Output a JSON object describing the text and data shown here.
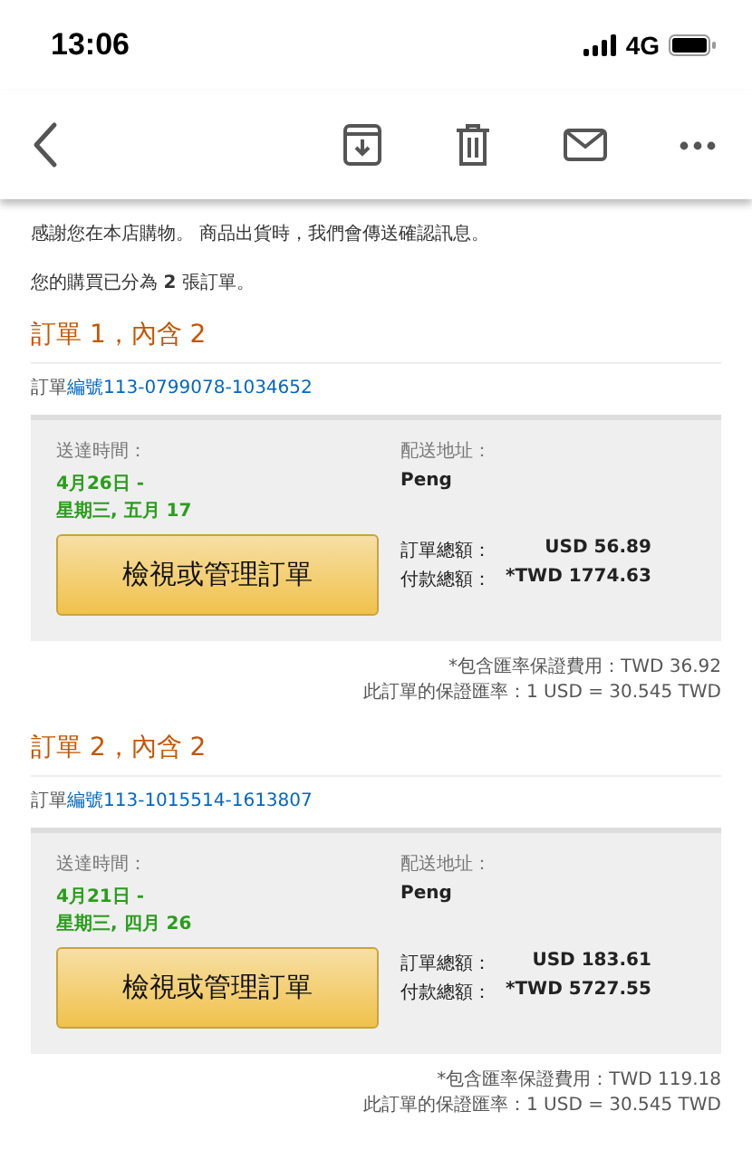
{
  "status_bar": {
    "time": "13:06",
    "network": "4G"
  },
  "messages": [
    "感謝您在本店購物。 商品出貨時，我們會傳送確認訊息。",
    "您的購買已分為 **2** 張訂單。"
  ],
  "orders": [
    {
      "heading": "訂單 1，內含 2",
      "number_label": "訂單",
      "number_link": "編號113-0799078-1034652",
      "delivery_label": "送達時間：",
      "delivery_dates": [
        "4月26日 -",
        "星期三, 五月 17"
      ],
      "button": "檢視或管理訂單",
      "address_label": "配送地址：",
      "recipient": "Peng",
      "totals": [
        {
          "label": "訂單總額：",
          "value": "USD 56.89"
        },
        {
          "label": "付款總額：",
          "value": "*TWD 1774.63"
        }
      ],
      "notes": [
        "*包含匯率保證費用：TWD 36.92",
        "此訂單的保證匯率：1 USD = 30.545 TWD"
      ]
    },
    {
      "heading": "訂單 2，內含 2",
      "number_label": "訂單",
      "number_link": "編號113-1015514-1613807",
      "delivery_label": "送達時間：",
      "delivery_dates": [
        "4月21日 -",
        "星期三, 四月 26"
      ],
      "button": "檢視或管理訂單",
      "address_label": "配送地址：",
      "recipient": "Peng",
      "totals": [
        {
          "label": "訂單總額：",
          "value": "USD 183.61"
        },
        {
          "label": "付款總額：",
          "value": "*TWD 5727.55"
        }
      ],
      "notes": [
        "*包含匯率保證費用：TWD 119.18",
        "此訂單的保證匯率：1 USD = 30.545 TWD"
      ]
    }
  ]
}
